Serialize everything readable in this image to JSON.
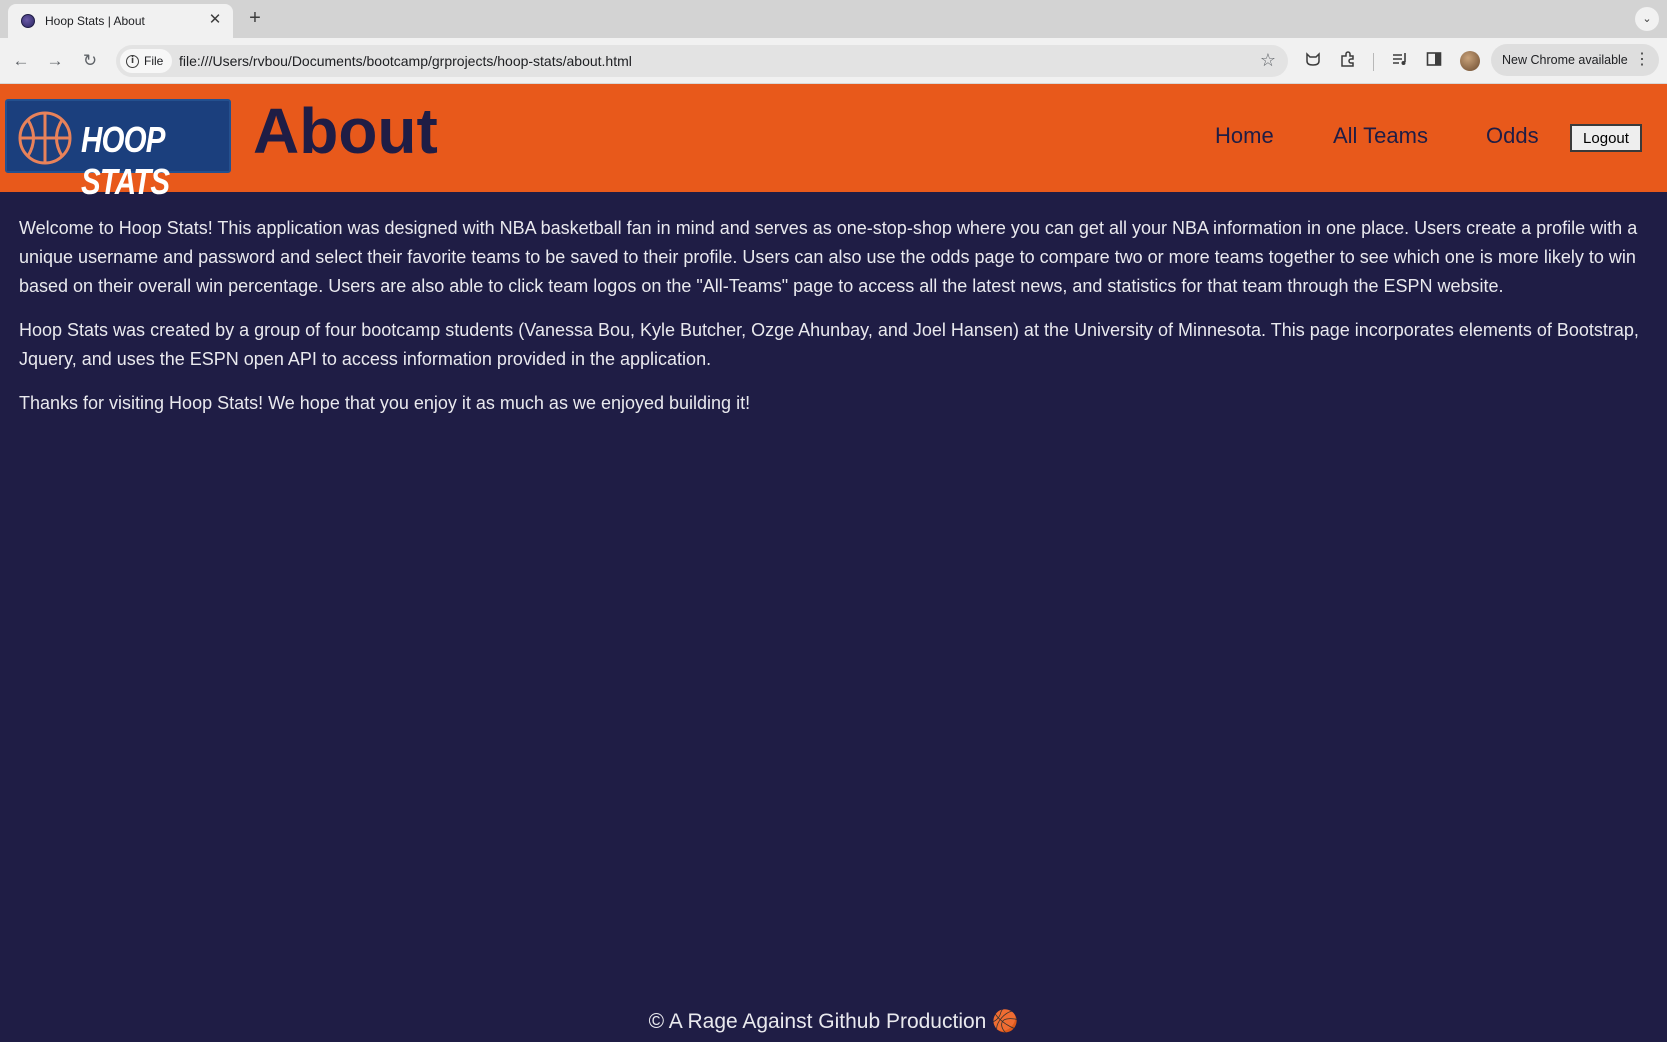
{
  "browser": {
    "tab_title": "Hoop Stats | About",
    "tab_close": "✕",
    "new_tab": "+",
    "tab_search": "⌄",
    "back": "←",
    "forward": "→",
    "reload": "↻",
    "file_label": "File",
    "url": "file:///Users/rvbou/Documents/bootcamp/grprojects/hoop-stats/about.html",
    "bookmark_icon": "☆",
    "update_label": "New Chrome available",
    "menu_icon": "⋮"
  },
  "header": {
    "logo_text": "HOOP STATS",
    "title": "About",
    "nav": [
      "Home",
      "All Teams",
      "Odds"
    ],
    "logout_label": "Logout",
    "accent_color": "#e8591b"
  },
  "main": {
    "paragraphs": [
      "Welcome to Hoop Stats! This application was designed with NBA basketball fan in mind and serves as one-stop-shop where you can get all your NBA information in one place. Users create a profile with a unique username and password and select their favorite teams to be saved to their profile. Users can also use the odds page to compare two or more teams together to see which one is more likely to win based on their overall win percentage. Users are also able to click team logos on the \"All-Teams\" page to access all the latest news, and statistics for that team through the ESPN website.",
      "Hoop Stats was created by a group of four bootcamp students (Vanessa Bou, Kyle Butcher, Ozge Ahunbay, and Joel Hansen) at the University of Minnesota. This page incorporates elements of Bootstrap, Jquery, and uses the ESPN open API to access information provided in the application.",
      "Thanks for visiting Hoop Stats! We hope that you enjoy it as much as we enjoyed building it!"
    ]
  },
  "footer": {
    "text": "© A Rage Against Github Production 🏀"
  },
  "colors": {
    "background": "#1f1d45",
    "header": "#e8591b",
    "logo_bg": "#1b3f7d"
  }
}
